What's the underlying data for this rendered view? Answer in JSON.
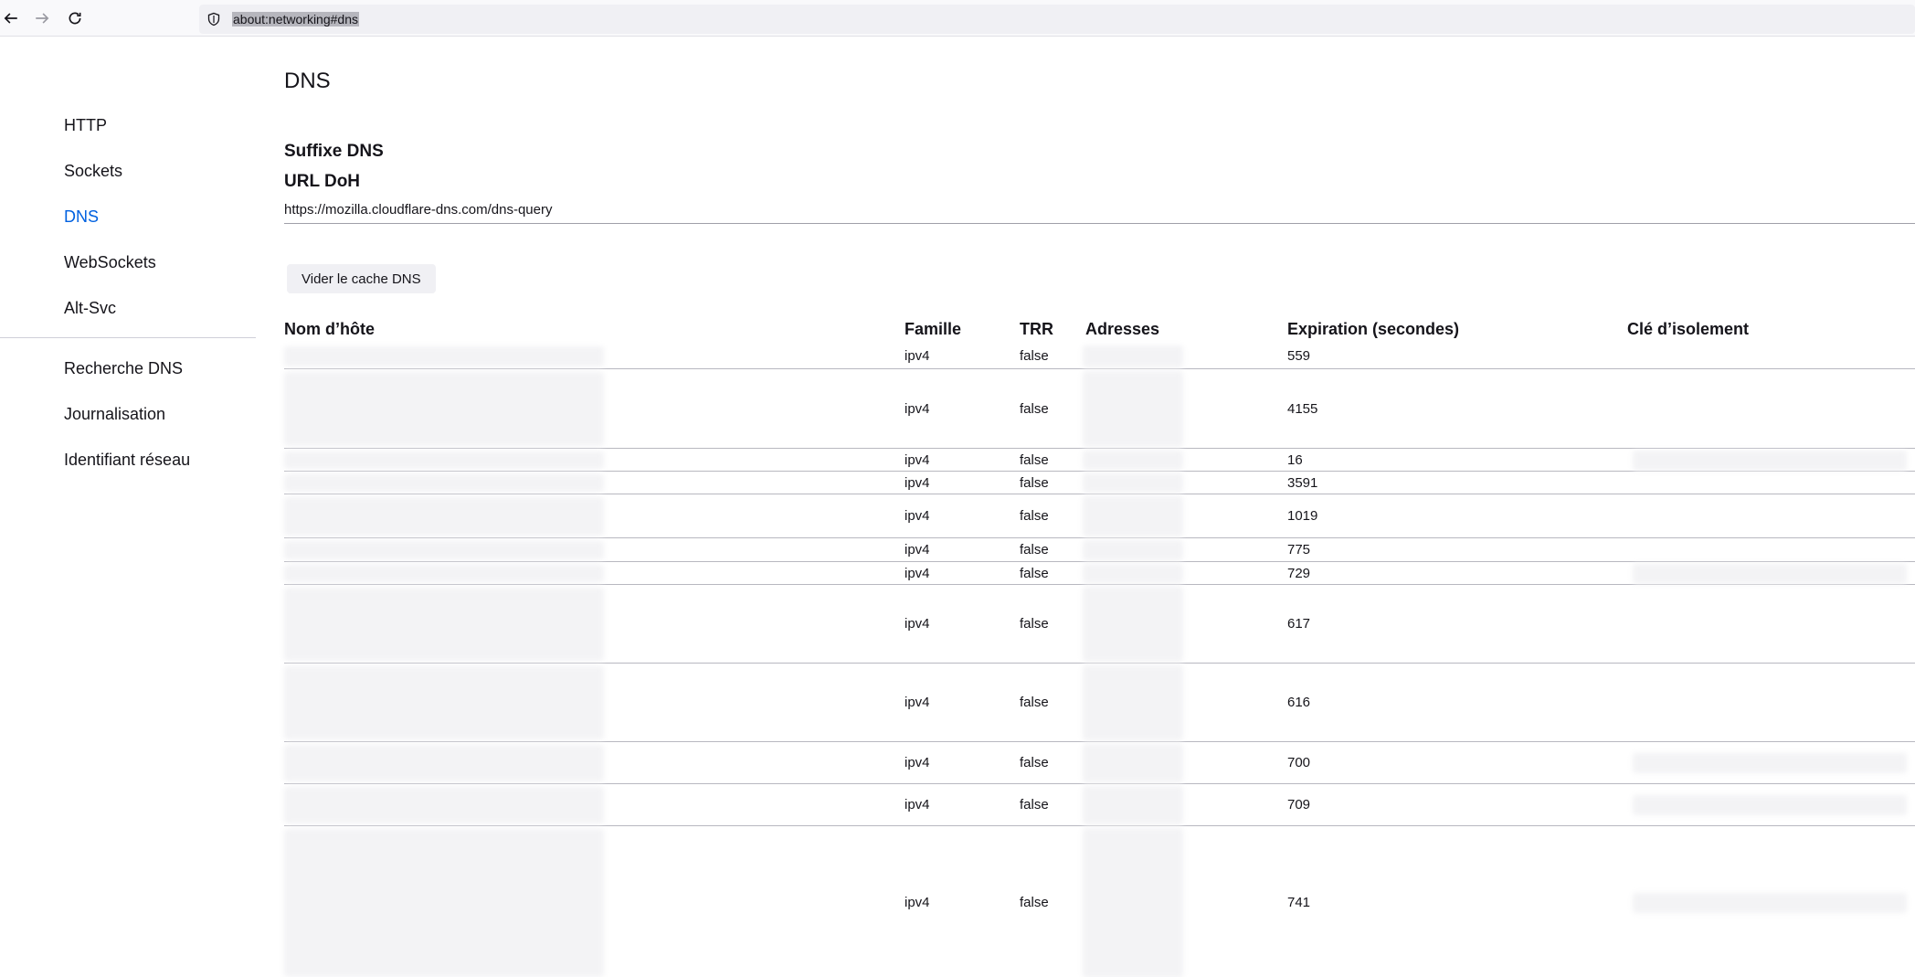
{
  "browser": {
    "url": "about:networking#dns"
  },
  "sidebar": {
    "items": [
      {
        "label": "HTTP",
        "active": false
      },
      {
        "label": "Sockets",
        "active": false
      },
      {
        "label": "DNS",
        "active": true
      },
      {
        "label": "WebSockets",
        "active": false
      },
      {
        "label": "Alt-Svc",
        "active": false
      },
      {
        "label": "Recherche DNS",
        "active": false
      },
      {
        "label": "Journalisation",
        "active": false
      },
      {
        "label": "Identifiant réseau",
        "active": false
      }
    ]
  },
  "main": {
    "title": "DNS",
    "dns_suffix_label": "Suffixe DNS",
    "doh_url_label": "URL DoH",
    "doh_url": "https://mozilla.cloudflare-dns.com/dns-query",
    "clear_cache_button": "Vider le cache DNS",
    "table": {
      "headers": [
        "Nom d’hôte",
        "Famille",
        "TRR",
        "Adresses",
        "Expiration (secondes)",
        "Clé d’isolement"
      ],
      "rows": [
        {
          "family": "ipv4",
          "trr": "false",
          "expiration": "559"
        },
        {
          "family": "ipv4",
          "trr": "false",
          "expiration": "4155"
        },
        {
          "family": "ipv4",
          "trr": "false",
          "expiration": "16"
        },
        {
          "family": "ipv4",
          "trr": "false",
          "expiration": "3591"
        },
        {
          "family": "ipv4",
          "trr": "false",
          "expiration": "1019"
        },
        {
          "family": "ipv4",
          "trr": "false",
          "expiration": "775"
        },
        {
          "family": "ipv4",
          "trr": "false",
          "expiration": "729"
        },
        {
          "family": "ipv4",
          "trr": "false",
          "expiration": "617"
        },
        {
          "family": "ipv4",
          "trr": "false",
          "expiration": "616"
        },
        {
          "family": "ipv4",
          "trr": "false",
          "expiration": "700"
        },
        {
          "family": "ipv4",
          "trr": "false",
          "expiration": "709"
        },
        {
          "family": "ipv4",
          "trr": "false",
          "expiration": "741"
        }
      ]
    }
  }
}
